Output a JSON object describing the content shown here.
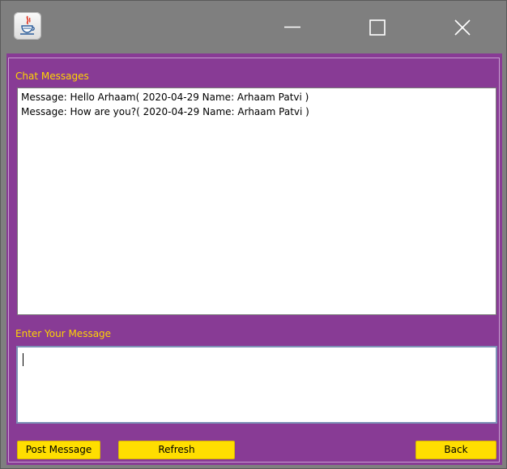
{
  "window": {
    "icon": "java-cup-icon"
  },
  "chat": {
    "section_label": "Chat Messages",
    "messages": [
      "Message: Hello Arhaam( 2020-04-29 Name: Arhaam Patvi )",
      "Message: How are you?( 2020-04-29 Name: Arhaam Patvi )"
    ]
  },
  "compose": {
    "section_label": "Enter Your Message",
    "value": ""
  },
  "buttons": {
    "post": "Post Message",
    "refresh": "Refresh",
    "back": "Back"
  },
  "colors": {
    "panel_bg": "#883b95",
    "label_text": "#ffd400",
    "button_bg": "#ffde00",
    "titlebar_bg": "#7f7f7f"
  }
}
